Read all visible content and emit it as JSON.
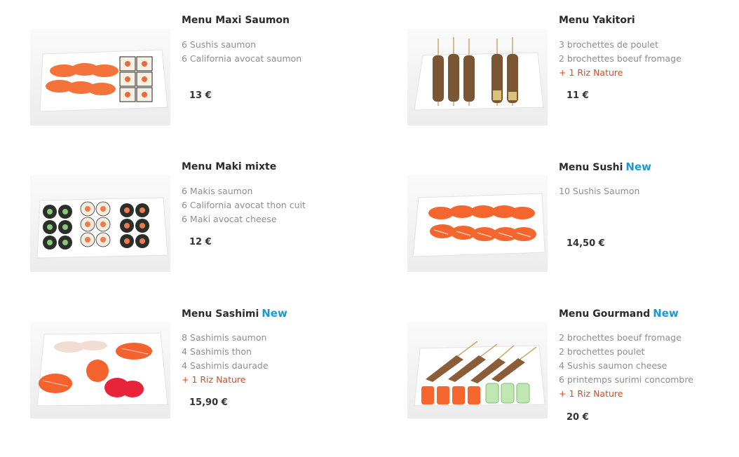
{
  "menus": [
    {
      "title": "Menu Maxi Saumon",
      "badge": "",
      "items": [
        "6 Sushis saumon",
        "6 California avocat saumon"
      ],
      "extra": "",
      "price": "13 €"
    },
    {
      "title": "Menu Yakitori",
      "badge": "",
      "items": [
        "3 brochettes de poulet",
        "2 brochettes boeuf fromage"
      ],
      "extra": "+ 1 Riz Nature",
      "price": "11 €"
    },
    {
      "title": "Menu Maki mixte",
      "badge": "",
      "items": [
        "6 Makis saumon",
        "6 California avocat thon cuit",
        "6 Maki avocat cheese"
      ],
      "extra": "",
      "price": "12 €"
    },
    {
      "title": "Menu Sushi",
      "badge": "New",
      "items": [
        "10 Sushis Saumon"
      ],
      "extra": "",
      "price": "14,50 €"
    },
    {
      "title": "Menu Sashimi",
      "badge": "New",
      "items": [
        "8 Sashimis saumon",
        "4 Sashimis thon",
        "4 Sashimis daurade"
      ],
      "extra": "+ 1 Riz Nature",
      "price": "15,90 €"
    },
    {
      "title": "Menu Gourmand",
      "badge": "New",
      "items": [
        "2 brochettes boeuf fromage",
        "2 brochettes poulet",
        "4 Sushis saumon cheese",
        "6 printemps surimi concombre"
      ],
      "extra": "+ 1 Riz Nature",
      "price": "20 €"
    }
  ],
  "colors": {
    "title": "#2b2b2b",
    "item": "#8e8e8e",
    "extra": "#e8451f",
    "badge": "#1a9ad0",
    "price": "#333333"
  }
}
